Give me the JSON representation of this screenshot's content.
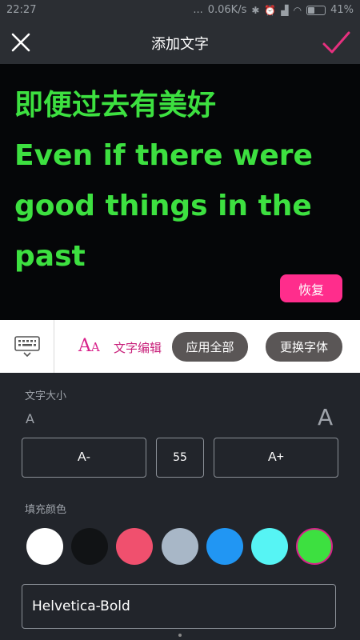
{
  "status_bar": {
    "time": "22:27",
    "signal_dots": "...",
    "net_speed": "0.06K/s",
    "battery_percent_text": "41%",
    "battery_level": 0.41
  },
  "header": {
    "title": "添加文字",
    "close_icon": "close-icon",
    "confirm_icon": "check-icon",
    "confirm_color": "#e6307e"
  },
  "preview": {
    "lines": [
      "即便过去有美好",
      "Even if there were",
      "good things in the",
      "past"
    ],
    "text_color": "#3de040",
    "restore_label": "恢复",
    "restore_color": "#ff2d8c"
  },
  "toolbar": {
    "keyboard_icon": "keyboard-icon",
    "font_icon": "font-style-icon",
    "font_icon_text": "AA",
    "text_edit_label": "文字编辑",
    "apply_all_label": "应用全部",
    "change_font_label": "更换字体"
  },
  "size_panel": {
    "label": "文字大小",
    "small_marker": "A",
    "large_marker": "A",
    "decrease_label": "A-",
    "value": "55",
    "increase_label": "A+"
  },
  "color_panel": {
    "label": "填充颜色",
    "swatches": [
      "#ffffff",
      "#111315",
      "#f0506e",
      "#a8b7c7",
      "#2196f3",
      "#56f4f4",
      "#3de040"
    ],
    "selected_index": 6
  },
  "font_field": {
    "value": "Helvetica-Bold"
  }
}
